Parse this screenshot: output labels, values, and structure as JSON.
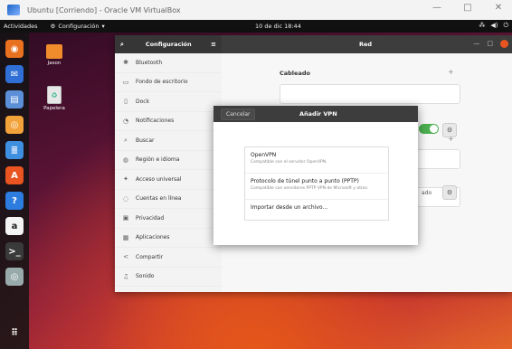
{
  "vbox": {
    "title": "Ubuntu [Corriendo] - Oracle VM VirtualBox",
    "controls": [
      "—",
      "□",
      "✕"
    ]
  },
  "topbar": {
    "activities": "Actividades",
    "app_menu": "Configuración",
    "clock": "10 de dic 18:44",
    "tray": [
      "⁂",
      "◀)",
      "⏻"
    ]
  },
  "desktop_icons": [
    {
      "label": "Jason"
    },
    {
      "label": "Papelera"
    }
  ],
  "dock": {
    "apps": [
      {
        "name": "firefox-icon",
        "color": "#e8711f",
        "glyph": "◉"
      },
      {
        "name": "thunderbird-icon",
        "color": "#2f6fd6",
        "glyph": "✉"
      },
      {
        "name": "files-icon",
        "color": "#5b8fd8",
        "glyph": "▤"
      },
      {
        "name": "rhythmbox-icon",
        "color": "#f2a23a",
        "glyph": "◎"
      },
      {
        "name": "libreoffice-writer-icon",
        "color": "#3f8fe0",
        "glyph": "≣"
      },
      {
        "name": "software-center-icon",
        "color": "#e95420",
        "glyph": "A"
      },
      {
        "name": "help-icon",
        "color": "#2d7de0",
        "glyph": "?"
      },
      {
        "name": "amazon-icon",
        "color": "#f4f4f4",
        "glyph": "a"
      },
      {
        "name": "terminal-icon",
        "color": "#3a3a3a",
        "glyph": ">_"
      },
      {
        "name": "dvd-icon",
        "color": "#9aa",
        "glyph": "◎"
      }
    ],
    "grid_glyph": "⠿"
  },
  "settings": {
    "header_title": "Configuración",
    "panel_title": "Red",
    "sidebar": [
      {
        "icon": "bluetooth-icon",
        "glyph": "✱",
        "label": "Bluetooth"
      },
      {
        "icon": "background-icon",
        "glyph": "▭",
        "label": "Fondo de escritorio"
      },
      {
        "icon": "dock-icon",
        "glyph": "▯",
        "label": "Dock"
      },
      {
        "icon": "notifications-icon",
        "glyph": "◔",
        "label": "Notificaciones"
      },
      {
        "icon": "search-icon",
        "glyph": "⌕",
        "label": "Buscar"
      },
      {
        "icon": "region-icon",
        "glyph": "◍",
        "label": "Región e idioma"
      },
      {
        "icon": "accessibility-icon",
        "glyph": "✦",
        "label": "Acceso universal"
      },
      {
        "icon": "online-accounts-icon",
        "glyph": "◌",
        "label": "Cuentas en línea"
      },
      {
        "icon": "privacy-icon",
        "glyph": "▣",
        "label": "Privacidad"
      },
      {
        "icon": "applications-icon",
        "glyph": "▦",
        "label": "Aplicaciones"
      },
      {
        "icon": "share-icon",
        "glyph": "<",
        "label": "Compartir"
      },
      {
        "icon": "sound-icon",
        "glyph": "♫",
        "label": "Sonido"
      }
    ],
    "wired_label": "Cableado",
    "obscured_value": "ado"
  },
  "dialog": {
    "cancel": "Cancelar",
    "title": "Añadir VPN",
    "options": [
      {
        "title": "OpenVPN",
        "desc": "Compatible con el servidor OpenVPN."
      },
      {
        "title": "Protocolo de túnel punto a punto (PPTP)",
        "desc": "Compatible con servidores PPTP VPN de Microsoft y otros."
      },
      {
        "title": "Importar desde un archivo…",
        "desc": ""
      }
    ]
  }
}
